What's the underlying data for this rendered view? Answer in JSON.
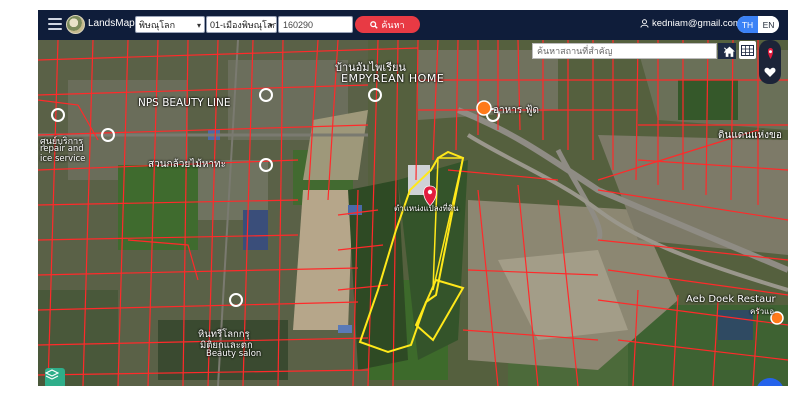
{
  "app": {
    "brand": "LandsMaps"
  },
  "header": {
    "province_select": "พิษณุโลก",
    "district_select": "01-เมืองพิษณุโลก",
    "code_input_value": "160290",
    "search_label": "ค้นหา",
    "user_email": "kedniam@gmail.com",
    "lang_th": "TH",
    "lang_en": "EN"
  },
  "map": {
    "place_search_placeholder": "ค้นหาสถานที่สำคัญ",
    "clear_symbol": "✕",
    "marker_label": "ตำแหน่งแปลงที่ดิน",
    "labels": {
      "empyrean_th": "บ้านอัมไพเรียน",
      "empyrean_en": "EMPYREAN HOME",
      "nps": "NPS BEAUTY LINE",
      "zone_th": "สวนกล้วยไม้หาทะ",
      "repair1": "ศูนย์บริการ",
      "repair2": "repair and",
      "repair3": "ice service",
      "food": "อาหาร ฟู้ด",
      "restaurant_th": "ดินแดนแห่งขอ",
      "aeb": "Aeb Doek Restaur",
      "aeb_th": "ครัวแอ",
      "salon_th1": "หินทรีโลกกรุ",
      "salon_th2": "มิติยกและตก",
      "salon_en": "Beauty salon"
    }
  },
  "colors": {
    "topbar": "#0f1d3a",
    "search_button": "#e83a44",
    "parcel_lines": "#ff2a2a",
    "highlight_parcel": "#ffe81a",
    "lang_active": "#3b82f6",
    "fab": "#2563eb"
  },
  "icons": {
    "menu": "hamburger-icon",
    "search": "search-icon",
    "user": "user-icon",
    "home": "home-icon",
    "grid": "grid-icon",
    "pin": "map-pin-icon",
    "heart": "heart-icon",
    "more": "more-icon"
  }
}
